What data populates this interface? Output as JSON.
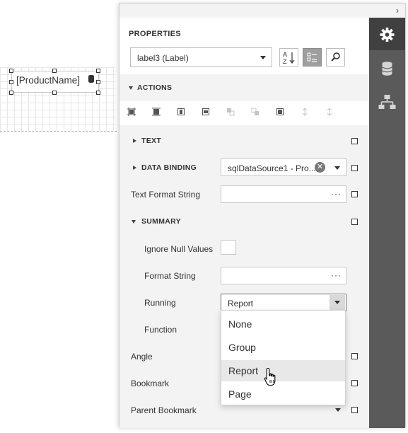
{
  "surface": {
    "label_text": "[ProductName]"
  },
  "panel": {
    "title": "PROPERTIES",
    "object_selector": "label3 (Label)",
    "actions_title": "ACTIONS",
    "sections": {
      "text": "TEXT",
      "data_binding": "DATA BINDING",
      "summary": "SUMMARY"
    },
    "properties": {
      "data_binding_value": "sqlDataSource1 - Pro...",
      "text_format_string": "Text Format String",
      "ignore_null_values": "Ignore Null Values",
      "format_string": "Format String",
      "running": "Running",
      "running_value": "Report",
      "function": "Function",
      "angle": "Angle",
      "bookmark": "Bookmark",
      "parent_bookmark": "Parent Bookmark"
    },
    "ellipsis": "···",
    "running_options": [
      "None",
      "Group",
      "Report",
      "Page"
    ],
    "hovered_option": "Report"
  },
  "side_tabs": [
    {
      "name": "properties",
      "icon": "gear-icon",
      "active": true
    },
    {
      "name": "field-list",
      "icon": "database-icon",
      "active": false
    },
    {
      "name": "report-explorer",
      "icon": "hierarchy-icon",
      "active": false
    }
  ],
  "colors": {
    "panel_bg": "#f3f3f3",
    "tab_strip": "#5a5a5a",
    "tab_active": "#404040",
    "toggle_active": "#9e9e9e",
    "hover_item": "#e8e8e8"
  }
}
